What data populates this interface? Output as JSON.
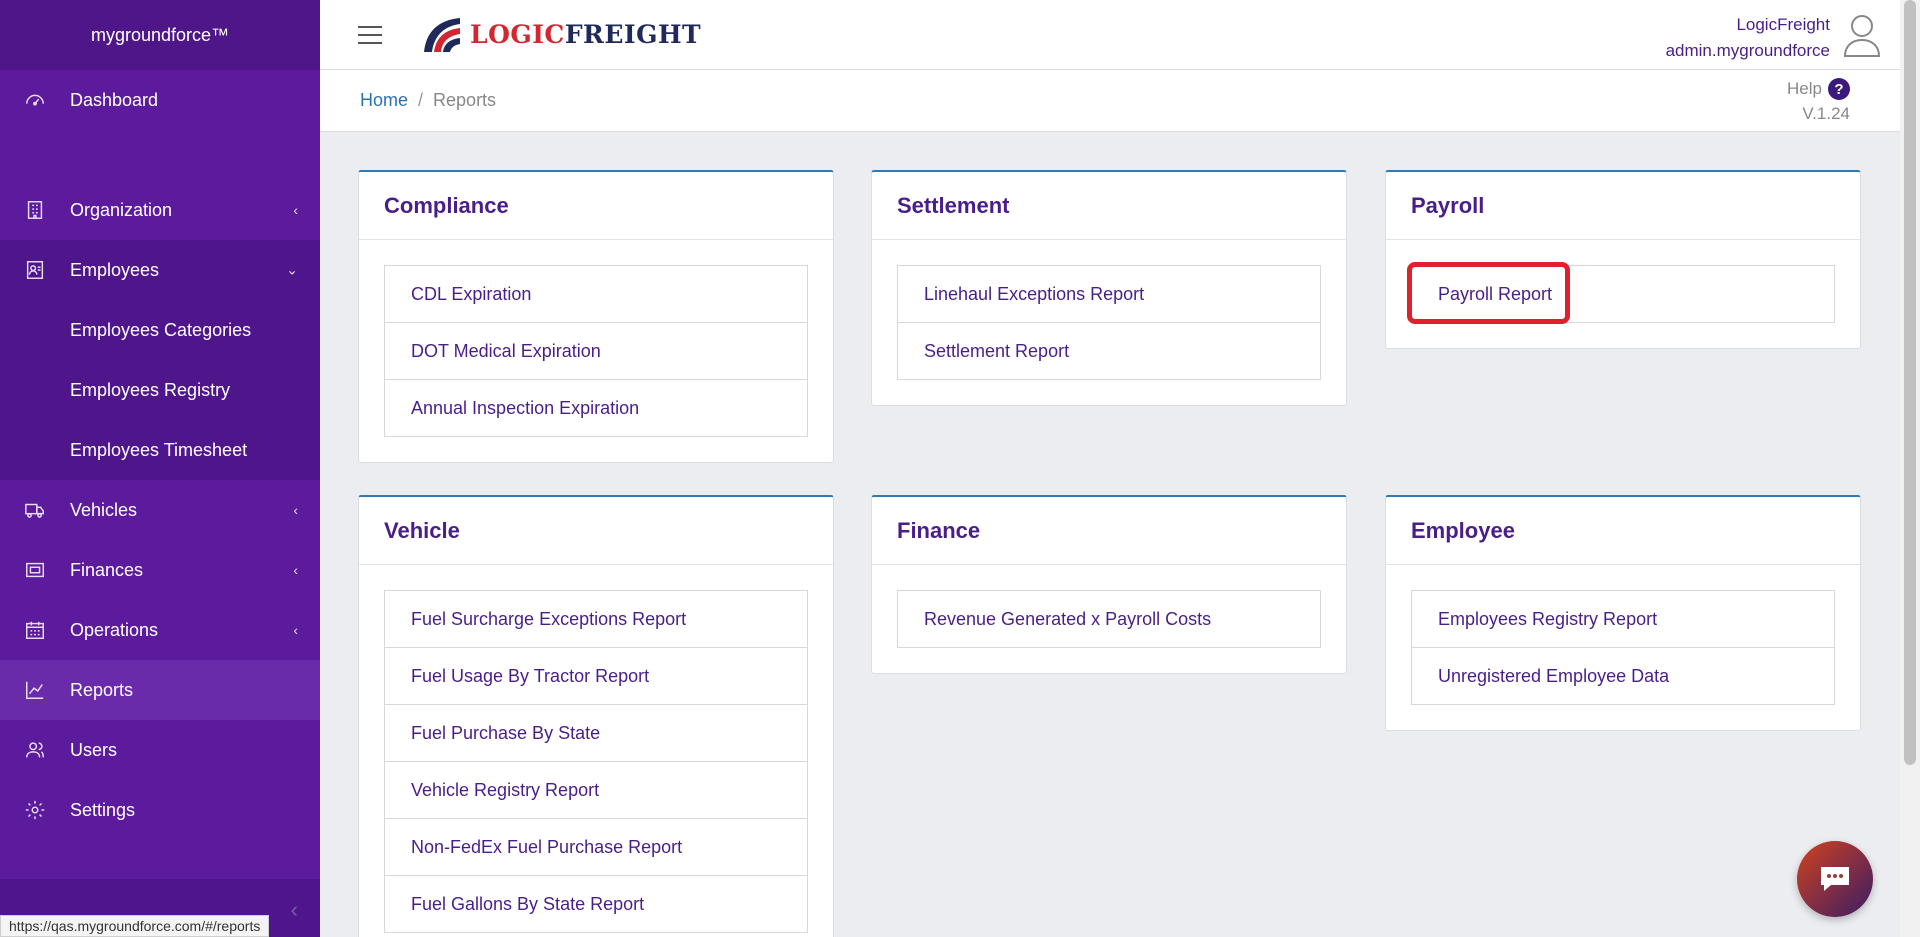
{
  "sidebar": {
    "brand": "mygroundforce™",
    "items": [
      {
        "label": "Dashboard",
        "icon": "gauge-icon"
      },
      {
        "label": "Organization",
        "icon": "building-icon"
      },
      {
        "label": "Employees",
        "icon": "id-card-icon"
      },
      {
        "label": "Vehicles",
        "icon": "truck-icon"
      },
      {
        "label": "Finances",
        "icon": "money-icon"
      },
      {
        "label": "Operations",
        "icon": "calendar-icon"
      },
      {
        "label": "Reports",
        "icon": "chart-line-icon"
      },
      {
        "label": "Users",
        "icon": "users-icon"
      },
      {
        "label": "Settings",
        "icon": "gear-icon"
      }
    ],
    "employees_sub": [
      "Employees Categories",
      "Employees Registry",
      "Employees Timesheet"
    ],
    "active": "Reports"
  },
  "header": {
    "logo_part1": "LOGIC",
    "logo_part2": "FREIGHT",
    "user_name": "LogicFreight",
    "user_org": "admin.mygroundforce"
  },
  "breadcrumb": {
    "home": "Home",
    "separator": "/",
    "current": "Reports"
  },
  "help": {
    "label": "Help",
    "icon": "?",
    "version": "V.1.24"
  },
  "cards": {
    "compliance": {
      "title": "Compliance",
      "items": [
        "CDL Expiration",
        "DOT Medical Expiration",
        "Annual Inspection Expiration"
      ]
    },
    "settlement": {
      "title": "Settlement",
      "items": [
        "Linehaul Exceptions Report",
        "Settlement Report"
      ]
    },
    "payroll": {
      "title": "Payroll",
      "items": [
        "Payroll Report"
      ]
    },
    "vehicle": {
      "title": "Vehicle",
      "items": [
        "Fuel Surcharge Exceptions Report",
        "Fuel Usage By Tractor Report",
        "Fuel Purchase By State",
        "Vehicle Registry Report",
        "Non-FedEx Fuel Purchase Report",
        "Fuel Gallons By State Report"
      ]
    },
    "finance": {
      "title": "Finance",
      "items": [
        "Revenue Generated x Payroll Costs"
      ]
    },
    "employee": {
      "title": "Employee",
      "items": [
        "Employees Registry Report",
        "Unregistered Employee Data"
      ]
    }
  },
  "status_url": "https://qas.mygroundforce.com/#/reports",
  "colors": {
    "sidebar": "#5c1b9c",
    "accent_text": "#4a1e8a",
    "card_top_border": "#2c7ab8",
    "highlight": "#e0202a"
  }
}
